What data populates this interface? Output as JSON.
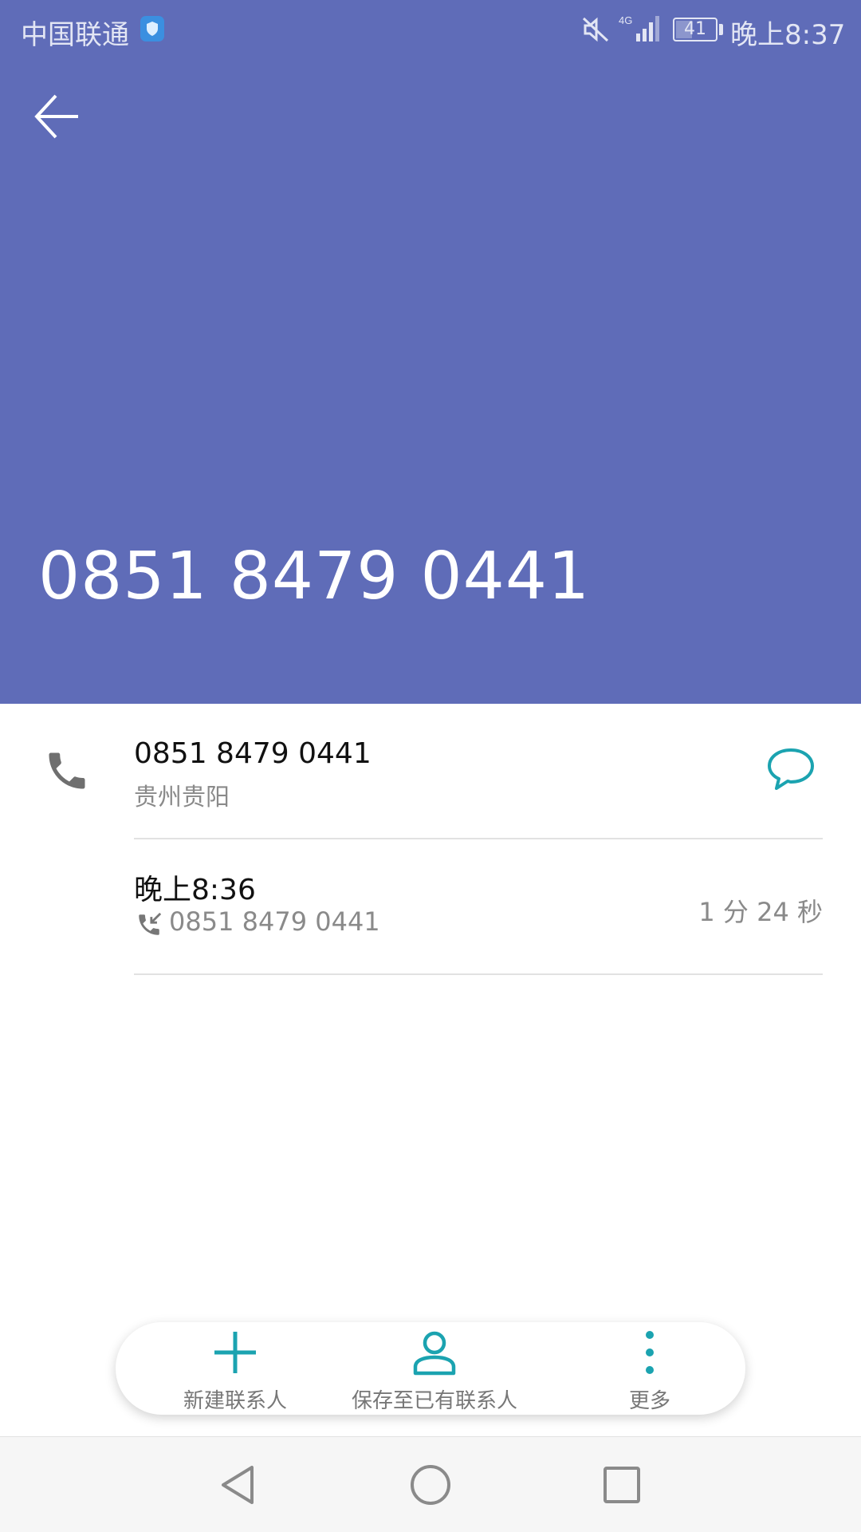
{
  "status_bar": {
    "carrier": "中国联通",
    "network": "4G",
    "battery": "41",
    "battery_level_percent": 41,
    "time": "晚上8:37"
  },
  "header": {
    "phone_number": "0851 8479 0441",
    "background_color": "#5f6cb8"
  },
  "detail": {
    "number": "0851 8479 0441",
    "location": "贵州贵阳"
  },
  "call_log": {
    "time": "晚上8:36",
    "number": "0851 8479 0441",
    "duration": "1 分 24 秒",
    "direction_icon": "incoming-call-icon"
  },
  "actions": {
    "new_contact": "新建联系人",
    "save_existing": "保存至已有联系人",
    "more": "更多"
  },
  "colors": {
    "accent": "#1ba3b0",
    "icon_gray": "#6f6f6f"
  }
}
